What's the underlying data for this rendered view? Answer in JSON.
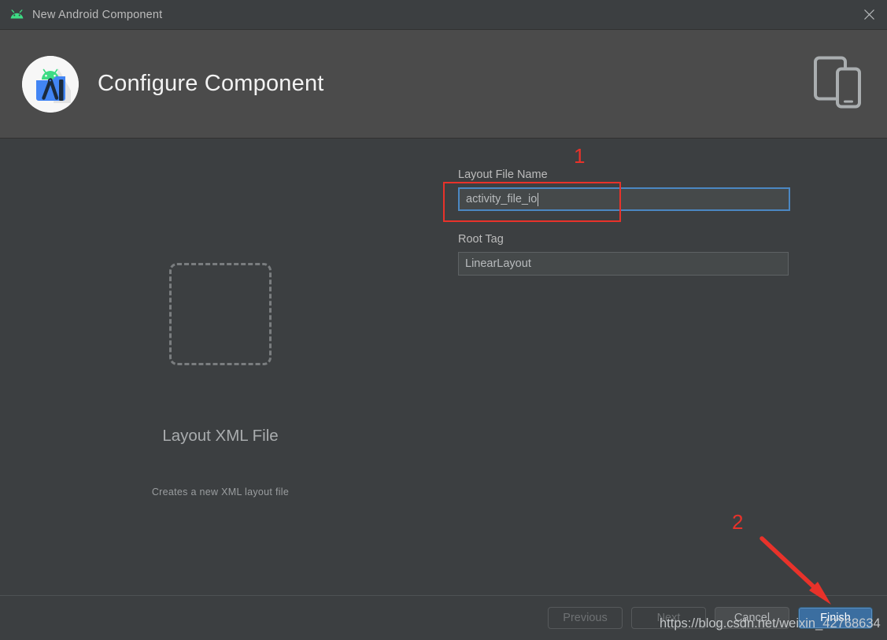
{
  "window": {
    "title": "New Android Component",
    "app_icon": "android-robot-icon",
    "close_icon": "close-icon"
  },
  "header": {
    "title": "Configure Component",
    "logo_icon": "android-studio-logo-icon",
    "device_icon": "tablet-and-phone-icon"
  },
  "preview": {
    "placeholder_icon": "dashed-square-placeholder-icon",
    "title": "Layout XML File",
    "description": "Creates a new XML layout file"
  },
  "form": {
    "layout_file_name": {
      "label": "Layout File Name",
      "value": "activity_file_io"
    },
    "root_tag": {
      "label": "Root Tag",
      "value": "LinearLayout"
    }
  },
  "footer": {
    "previous_label": "Previous",
    "next_label": "Next",
    "cancel_label": "Cancel",
    "finish_label": "Finish"
  },
  "annotations": {
    "marker_one": "1",
    "marker_two": "2",
    "accent_color": "#e8322a"
  },
  "watermark": {
    "text": "https://blog.csdn.net/weixin_42768634"
  },
  "colors": {
    "dialog_bg": "#3c3f41",
    "header_bg": "#4b4b4b",
    "focus_blue": "#4b87c2",
    "primary_button": "#3b6ea0"
  }
}
